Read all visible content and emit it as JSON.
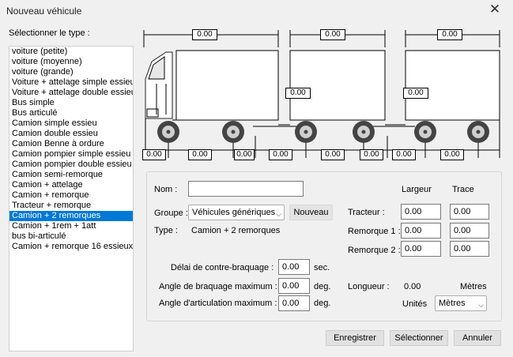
{
  "window": {
    "title": "Nouveau véhicule",
    "close_glyph": "✕"
  },
  "left": {
    "label": "Sélectionner le type :",
    "items": [
      "voiture (petite)",
      "voiture (moyenne)",
      "voiture (grande)",
      "Voiture + attelage simple essieu",
      "Voiture + attelage double essieu",
      "Bus simple",
      "Bus articulé",
      "Camion simple essieu",
      "Camion double essieu",
      "Camion Benne à ordure",
      "Camion pompier simple essieu",
      "Camion pompier double essieu",
      "Camion semi-remorque",
      "Camion + attelage",
      "Camion + remorque",
      "Tracteur + remorque",
      "Camion + 2 remorques",
      "Camion + 1rem + 1att",
      "bus bi-articulé",
      "Camion + remorque 16 essieux"
    ],
    "selected": 16
  },
  "diagram": {
    "top_lengths": [
      "0.00",
      "0.00",
      "0.00"
    ],
    "hitch_values": [
      "0.00",
      "0.00"
    ],
    "bottom_values": [
      "0.00",
      "0.00",
      "0.00",
      "0.00",
      "0.00",
      "0.00",
      "0.00",
      "0.00"
    ]
  },
  "form": {
    "name_label": "Nom :",
    "name_value": "",
    "group_label": "Groupe :",
    "group_value": "Véhicules génériques",
    "new_button": "Nouveau",
    "type_label": "Type :",
    "type_value": "Camion + 2 remorques",
    "header_width": "Largeur",
    "header_track": "Trace",
    "tractor_label": "Tracteur :",
    "trailer1_label": "Remorque 1 :",
    "trailer2_label": "Remorque 2 :",
    "tractor_width": "0.00",
    "tractor_track": "0.00",
    "trailer1_width": "0.00",
    "trailer1_track": "0.00",
    "trailer2_width": "0.00",
    "trailer2_track": "0.00",
    "countersteer_label": "Délai de contre-braquage :",
    "countersteer_value": "0.00",
    "countersteer_unit": "sec.",
    "maxsteer_label": "Angle de braquage maximum :",
    "maxsteer_value": "0.00",
    "maxsteer_unit": "deg.",
    "maxartic_label": "Angle d'articulation maximum :",
    "maxartic_value": "0.00",
    "maxartic_unit": "deg.",
    "length_label": "Longueur :",
    "length_value": "0.00",
    "length_unit": "Mètres",
    "units_label": "Unités",
    "units_value": "Mètres"
  },
  "buttons": {
    "save": "Enregistrer",
    "select": "Sélectionner",
    "cancel": "Annuler"
  }
}
